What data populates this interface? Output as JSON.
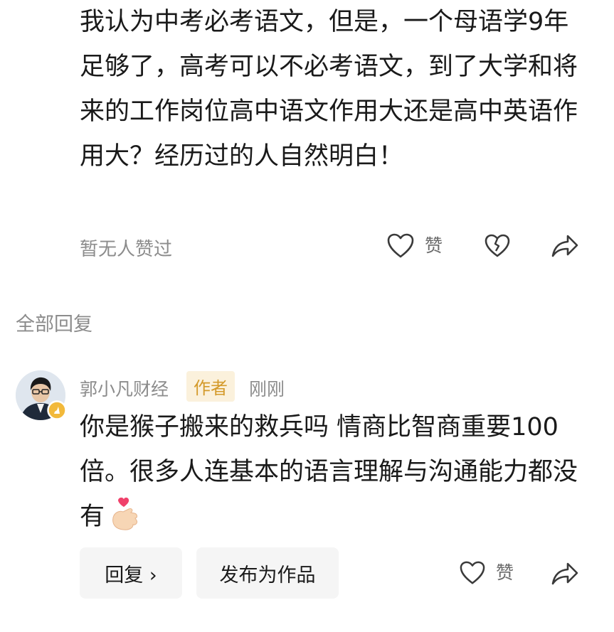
{
  "original_comment": {
    "text": "我认为中考必考语文，但是，一个母语学9年足够了，高考可以不必考语文，到了大学和将来的工作岗位高中语文作用大还是高中英语作用大？经历过的人自然明白！",
    "no_likes_text": "暂无人赞过",
    "like_label": "赞"
  },
  "replies_section": {
    "title": "全部回复"
  },
  "reply": {
    "author": "郭小凡财经",
    "badge": "作者",
    "time": "刚刚",
    "text": "你是猴子搬来的救兵吗 情商比智商重要100倍。很多人连基本的语言理解与沟通能力都没有",
    "reply_button": "回复 ›",
    "publish_button": "发布为作品",
    "like_label": "赞"
  },
  "icons": {
    "like": "heart-outline-icon",
    "dislike": "broken-heart-icon",
    "share": "share-arrow-icon",
    "emoji": "finger-heart-emoji-icon",
    "verified": "verified-badge-icon"
  },
  "colors": {
    "text": "#1a1a1a",
    "muted": "#8c8c8c",
    "badge_bg": "#fbf1dc",
    "badge_fg": "#d49a2a",
    "pill_bg": "#f5f5f5"
  }
}
